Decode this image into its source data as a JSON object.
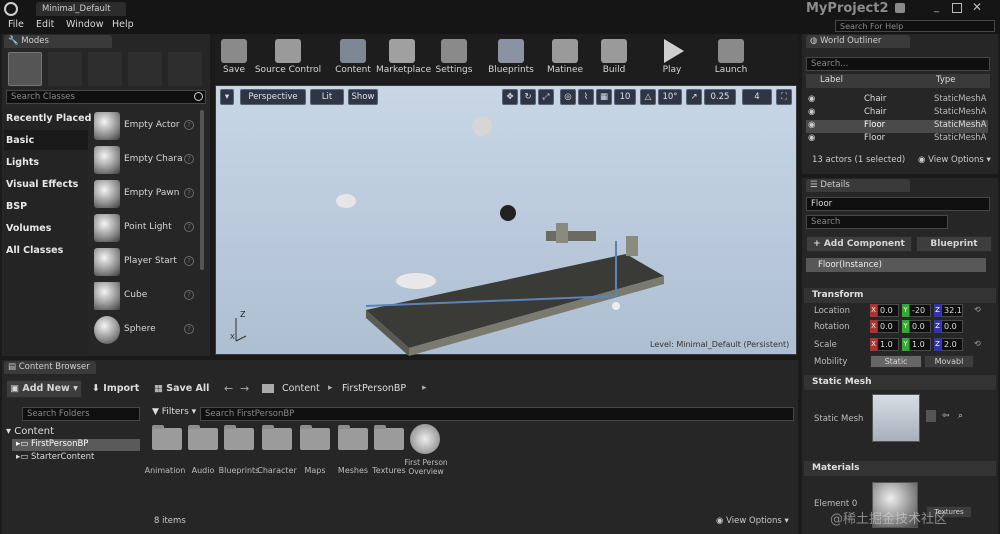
{
  "window": {
    "tab_title": "Minimal_Default",
    "project_name": "MyProject2",
    "search_for_help_placeholder": "Search For Help"
  },
  "menu": [
    "File",
    "Edit",
    "Window",
    "Help"
  ],
  "modes": {
    "tab_label": "Modes",
    "search_placeholder": "Search Classes",
    "categories": [
      "Recently Placed",
      "Basic",
      "Lights",
      "Visual Effects",
      "BSP",
      "Volumes",
      "All Classes"
    ],
    "items": [
      "Empty Actor",
      "Empty Chara",
      "Empty Pawn",
      "Point Light",
      "Player Start",
      "Cube",
      "Sphere"
    ]
  },
  "toolbar": {
    "buttons": [
      "Save",
      "Source Control",
      "Content",
      "Marketplace",
      "Settings",
      "Blueprints",
      "Matinee",
      "Build",
      "Play",
      "Launch"
    ]
  },
  "viewport": {
    "perspective_label": "Perspective",
    "lit_label": "Lit",
    "show_label": "Show",
    "grid_snap": "10",
    "rotation_snap": "10°",
    "scale_snap": "0.25",
    "camera_speed": "4",
    "level_label": "Level:  Minimal_Default (Persistent)",
    "axis_z": "Z",
    "axis_x": "X"
  },
  "world_outliner": {
    "tab_label": "World Outliner",
    "search_placeholder": "Search...",
    "col_label": "Label",
    "col_type": "Type",
    "rows": [
      {
        "label": "Chair",
        "type": "StaticMeshA"
      },
      {
        "label": "Chair",
        "type": "StaticMeshA"
      },
      {
        "label": "Floor",
        "type": "StaticMeshA"
      },
      {
        "label": "Floor",
        "type": "StaticMeshA"
      }
    ],
    "actor_count": "13 actors (1 selected)",
    "view_options": "View Options"
  },
  "details": {
    "tab_label": "Details",
    "name_value": "Floor",
    "search_placeholder": "Search",
    "add_component_label": "+ Add Component",
    "blueprint_label": "Blueprint",
    "instance_label": "Floor(Instance)",
    "transform_header": "Transform",
    "location_label": "Location",
    "rotation_label": "Rotation",
    "scale_label": "Scale",
    "mobility_label": "Mobility",
    "location": [
      "0.0",
      "-20",
      "32.1"
    ],
    "rotation": [
      "0.0",
      "0.0",
      "0.0"
    ],
    "scale": [
      "1.0",
      "1.0",
      "2.0"
    ],
    "mobility_static": "Static",
    "mobility_movable": "Movabl",
    "static_mesh_header": "Static Mesh",
    "static_mesh_label": "Static Mesh",
    "materials_header": "Materials",
    "element_label": "Element 0",
    "textures_label": "Textures"
  },
  "content_browser": {
    "tab_label": "Content Browser",
    "add_new_label": "Add New",
    "import_label": "Import",
    "save_all_label": "Save All",
    "path_root": "Content",
    "path_child": "FirstPersonBP",
    "search_folders_placeholder": "Search Folders",
    "filters_label": "Filters",
    "search_placeholder": "Search FirstPersonBP",
    "tree": [
      "Content",
      "FirstPersonBP",
      "StarterContent"
    ],
    "assets": [
      "Animation",
      "Audio",
      "Blueprints",
      "Character",
      "Maps",
      "Meshes",
      "Textures"
    ],
    "overview_asset": "First Person Overview",
    "item_count": "8 items",
    "view_options": "View Options"
  },
  "watermark": "@稀土掘金技术社区",
  "colors": {
    "accent_blue": "#4d7fc2",
    "selection": "#4a4a4a",
    "viewport_sky": "#b8c8da"
  }
}
